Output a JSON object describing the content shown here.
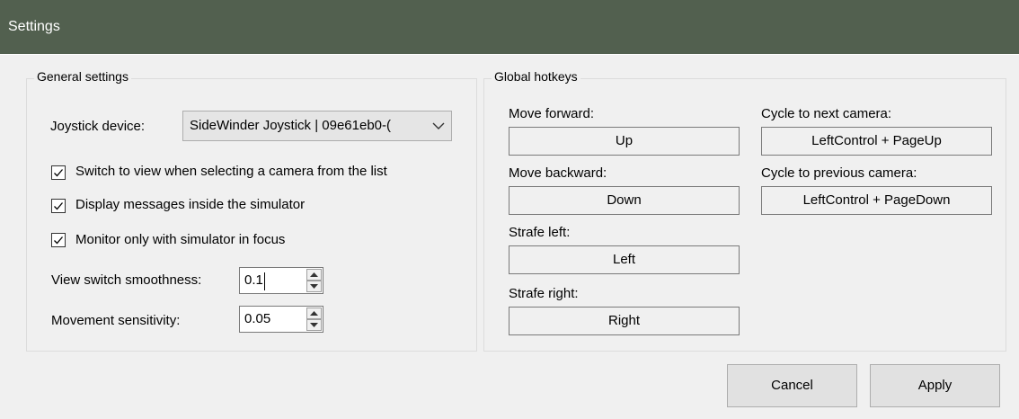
{
  "window": {
    "title": "Settings",
    "titlebar_color": "#52604f"
  },
  "general": {
    "legend": "General settings",
    "joystick_label": "Joystick device:",
    "joystick_value": "SideWinder Joystick | 09e61eb0-(",
    "checkboxes": [
      {
        "label": "Switch to view when selecting a camera from the list",
        "checked": true
      },
      {
        "label": "Display messages inside the simulator",
        "checked": true
      },
      {
        "label": "Monitor only with simulator in focus",
        "checked": true
      }
    ],
    "smoothness_label": "View switch smoothness:",
    "smoothness_value": "0.1",
    "sensitivity_label": "Movement sensitivity:",
    "sensitivity_value": "0.05"
  },
  "hotkeys": {
    "legend": "Global hotkeys",
    "items": [
      {
        "label": "Move forward:",
        "value": "Up"
      },
      {
        "label": "Move backward:",
        "value": "Down"
      },
      {
        "label": "Strafe left:",
        "value": "Left"
      },
      {
        "label": "Strafe right:",
        "value": "Right"
      },
      {
        "label": "Cycle to next camera:",
        "value": "LeftControl + PageUp"
      },
      {
        "label": "Cycle to previous camera:",
        "value": "LeftControl + PageDown"
      }
    ]
  },
  "buttons": {
    "cancel": "Cancel",
    "apply": "Apply"
  }
}
